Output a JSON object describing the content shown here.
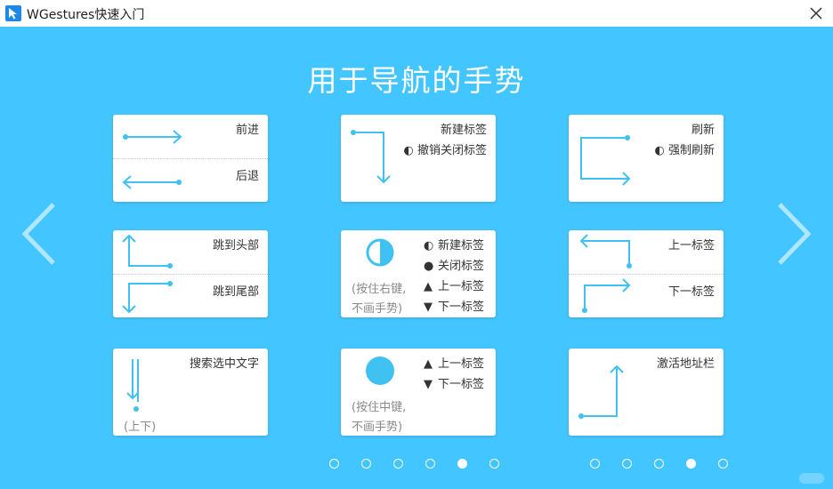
{
  "window": {
    "title": "WGestures快速入门"
  },
  "page": {
    "heading": "用于导航的手势",
    "cards": {
      "forward": "前进",
      "back": "后退",
      "new_tab": "新建标签",
      "undo_close": "撤销关闭标签",
      "refresh": "刷新",
      "force_refresh": "强制刷新",
      "jump_top": "跳到头部",
      "jump_bottom": "跳到尾部",
      "rb_new_tab": "新建标签",
      "rb_close_tab": "关闭标签",
      "rb_prev_tab": "上一标签",
      "rb_next_tab": "下一标签",
      "rb_note_1": "(按住右键,",
      "rb_note_2": "不画手势)",
      "prev_tab": "上一标签",
      "next_tab": "下一标签",
      "search_text": "搜索选中文字",
      "search_note": "(上下)",
      "mb_prev_tab": "上一标签",
      "mb_next_tab": "下一标签",
      "mb_note_1": "(按住中键,",
      "mb_note_2": "不画手势)",
      "address_bar": "激活地址栏"
    }
  },
  "symbols": {
    "half_circle": "◐",
    "full_circle": "●",
    "up": "▲",
    "down": "▼"
  },
  "pagination": {
    "left_active_index": 4,
    "right_active_index": 3
  },
  "colors": {
    "background": "#43c6ff",
    "gesture": "#3fc2f2",
    "card": "#ffffff"
  }
}
